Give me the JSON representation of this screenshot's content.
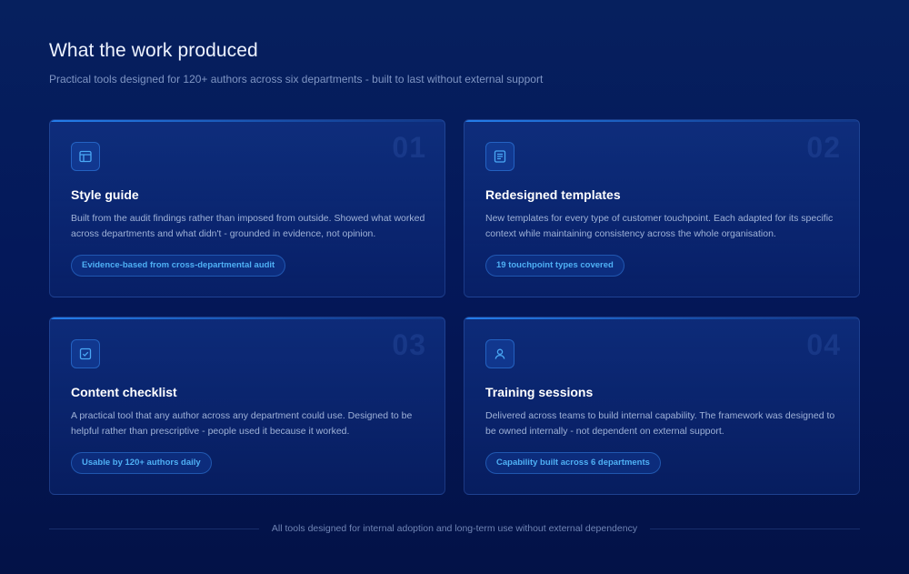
{
  "header": {
    "title": "What the work produced",
    "subtitle": "Practical tools designed for 120+ authors across six departments - built to last without external support"
  },
  "cards": [
    {
      "number": "01",
      "icon": "layout-icon",
      "title": "Style guide",
      "description": "Built from the audit findings rather than imposed from outside. Showed what worked across departments and what didn't - grounded in evidence, not opinion.",
      "badge": "Evidence-based from cross-departmental audit"
    },
    {
      "number": "02",
      "icon": "document-icon",
      "title": "Redesigned templates",
      "description": "New templates for every type of customer touchpoint. Each adapted for its specific context while maintaining consistency across the whole organisation.",
      "badge": "19 touchpoint types covered"
    },
    {
      "number": "03",
      "icon": "checkbox-icon",
      "title": "Content checklist",
      "description": "A practical tool that any author across any department could use. Designed to be helpful rather than prescriptive - people used it because it worked.",
      "badge": "Usable by 120+ authors daily"
    },
    {
      "number": "04",
      "icon": "user-icon",
      "title": "Training sessions",
      "description": "Delivered across teams to build internal capability. The framework was designed to be owned internally - not dependent on external support.",
      "badge": "Capability built across 6 departments"
    }
  ],
  "footer": {
    "text": "All tools designed for internal adoption and long-term use without external dependency"
  },
  "colors": {
    "background": "#04185a",
    "accent": "#4fb0f5",
    "card_border": "#2f5cb8"
  }
}
